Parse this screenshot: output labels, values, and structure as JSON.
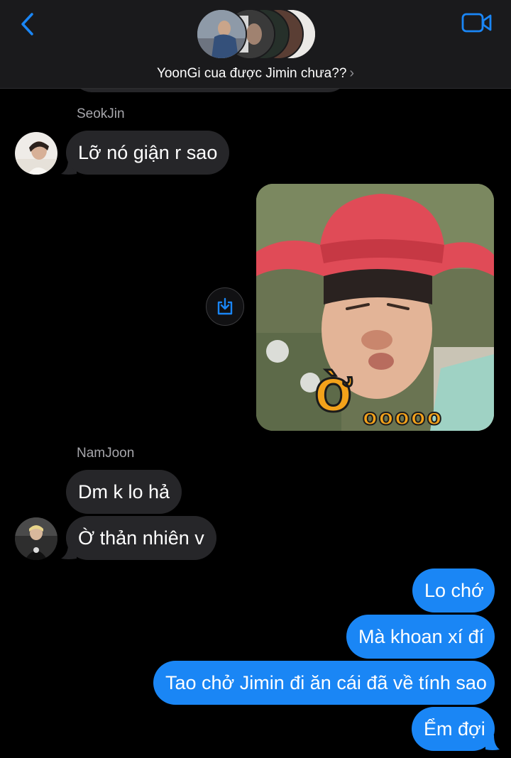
{
  "header": {
    "group_name": "YoonGi cua được Jimin chưa??",
    "chevron": "›",
    "back_icon": "chevron-left-icon",
    "video_icon": "video-camera-icon",
    "accent_color": "#1a86f5"
  },
  "messages": {
    "seokjin": {
      "sender": "SeokJin",
      "text": "Lỡ nó giận r sao"
    },
    "image": {
      "caption": "Ờ",
      "dots": "ooooo",
      "download_icon": "download-icon"
    },
    "namjoon": {
      "sender": "NamJoon",
      "text1": "Dm k lo hả",
      "text2": "Ờ thản nhiên v"
    },
    "outgoing": [
      "Lo chớ",
      "Mà khoan xí đí",
      "Tao chở Jimin đi ăn cái đã về tính sao",
      "Ểm đợi"
    ]
  },
  "colors": {
    "incoming_bubble": "#262629",
    "outgoing_bubble": "#1a86f5",
    "header_bg": "#1a1a1c",
    "sender_name": "#a6a6ab"
  }
}
